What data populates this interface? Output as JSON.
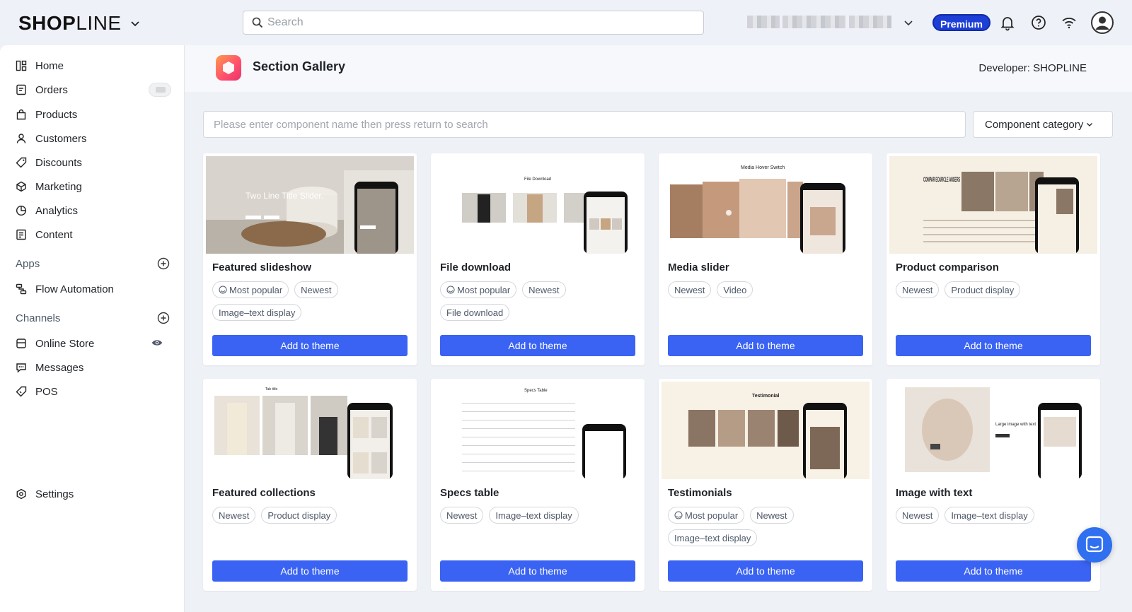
{
  "brand": {
    "name_bold": "SHOP",
    "name_light": "LINE"
  },
  "topbar": {
    "search_placeholder": "Search",
    "premium_label": "Premium",
    "icons": [
      "bell-icon",
      "help-icon",
      "wifi-icon",
      "avatar-icon"
    ]
  },
  "sidebar": {
    "items": [
      {
        "label": "Home",
        "icon": "home-icon"
      },
      {
        "label": "Orders",
        "icon": "orders-icon"
      },
      {
        "label": "Products",
        "icon": "products-icon"
      },
      {
        "label": "Customers",
        "icon": "customers-icon"
      },
      {
        "label": "Discounts",
        "icon": "discount-tag-icon"
      },
      {
        "label": "Marketing",
        "icon": "marketing-icon"
      },
      {
        "label": "Analytics",
        "icon": "analytics-icon"
      },
      {
        "label": "Content",
        "icon": "content-icon"
      }
    ],
    "apps_label": "Apps",
    "apps": [
      {
        "label": "Flow Automation",
        "icon": "flow-icon"
      }
    ],
    "channels_label": "Channels",
    "channels": [
      {
        "label": "Online Store",
        "icon": "store-icon"
      },
      {
        "label": "Messages",
        "icon": "messages-icon"
      },
      {
        "label": "POS",
        "icon": "pos-tag-icon"
      }
    ],
    "settings_label": "Settings"
  },
  "header": {
    "title": "Section Gallery",
    "developer": "Developer: SHOPLINE"
  },
  "filters": {
    "search_placeholder": "Please enter component name then press return to search",
    "category_label": "Component category"
  },
  "cards": [
    {
      "title": "Featured slideshow",
      "tags": [
        "Most popular",
        "Newest",
        "Image–text display"
      ],
      "button": "Add to theme",
      "thumb_text": "Two Line Title Slider."
    },
    {
      "title": "File download",
      "tags": [
        "Most popular",
        "Newest",
        "File download"
      ],
      "button": "Add to theme",
      "thumb_text": "File Download"
    },
    {
      "title": "Media slider",
      "tags": [
        "Newest",
        "Video"
      ],
      "button": "Add to theme",
      "thumb_text": "Media Hover Switch"
    },
    {
      "title": "Product comparison",
      "tags": [
        "Newest",
        "Product display"
      ],
      "button": "Add to theme",
      "thumb_text": "COMPAR EOURCLE ANSERS"
    },
    {
      "title": "Featured collections",
      "tags": [
        "Newest",
        "Product display"
      ],
      "button": "Add to theme",
      "thumb_text": "Tab title"
    },
    {
      "title": "Specs table",
      "tags": [
        "Newest",
        "Image–text display"
      ],
      "button": "Add to theme",
      "thumb_text": "Specs Table"
    },
    {
      "title": "Testimonials",
      "tags": [
        "Most popular",
        "Newest",
        "Image–text display"
      ],
      "button": "Add to theme",
      "thumb_text": "Testimonial"
    },
    {
      "title": "Image with text",
      "tags": [
        "Newest",
        "Image–text display"
      ],
      "button": "Add to theme",
      "thumb_text": "Large image with text"
    }
  ],
  "colors": {
    "accent": "#3a63f3",
    "premium": "#1e3fd6",
    "chat": "#2f6ff0"
  }
}
